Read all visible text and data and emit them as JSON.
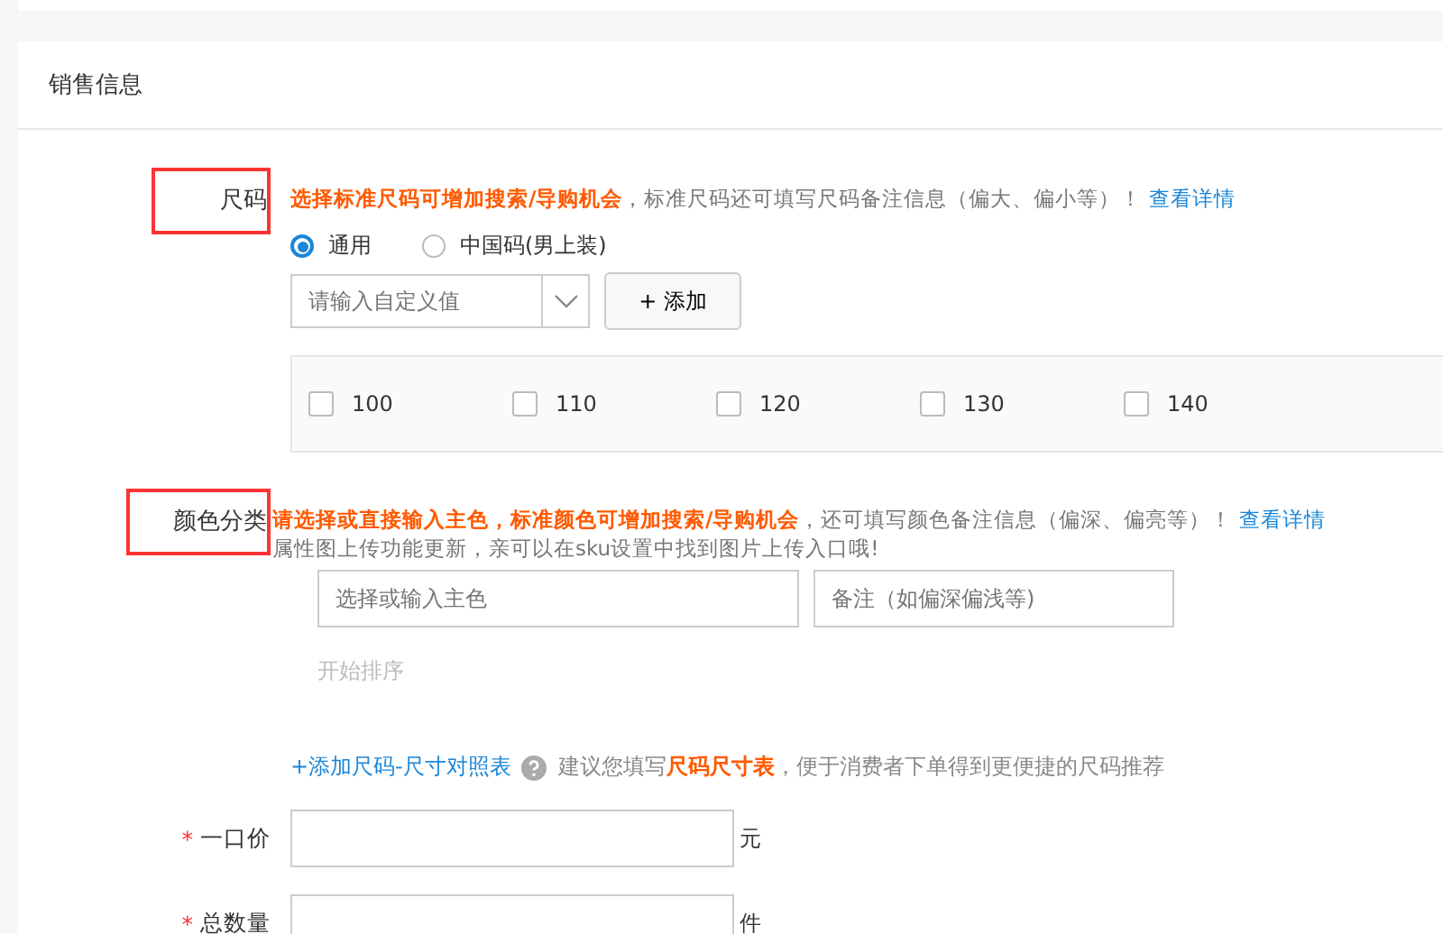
{
  "section_title": "销售信息",
  "size": {
    "label": "尺码",
    "highlighted": true,
    "hint": "**选择标准尺码可增加搜索/导购机会**，标准尺码还可填写尺码备注信息（偏大、偏小等）！",
    "link": "查看详情",
    "radios": [
      {
        "label": "通用",
        "selected": true
      },
      {
        "label": "中国码(男上装)",
        "selected": false
      }
    ],
    "custom_input": {
      "placeholder": "请输入自定义值"
    },
    "add_button": "+ 添加",
    "options": [
      {
        "label": "100",
        "checked": false
      },
      {
        "label": "110",
        "checked": false
      },
      {
        "label": "120",
        "checked": false
      },
      {
        "label": "130",
        "checked": false
      },
      {
        "label": "140",
        "checked": false
      }
    ]
  },
  "color": {
    "label": "颜色分类",
    "highlighted": true,
    "hint": "**请选择或直接输入主色，标准颜色可增加搜索/导购机会**，还可填写颜色备注信息（偏深、偏亮等）！",
    "link": "查看详情",
    "note": "属性图上传功能更新，亲可以在sku设置中找到图片上传入口哦!",
    "main_color": {
      "placeholder": "选择或输入主色"
    },
    "remark": {
      "placeholder": "备注（如偏深偏浅等)"
    },
    "sort": "开始排序"
  },
  "size_chart": {
    "link": "+添加尺码-尺寸对照表",
    "tip": "建议您填写**尺码尺寸表**，便于消费者下单得到更便捷的尺码推荐"
  },
  "fields": [
    {
      "required_mark": "*",
      "label": "一口价",
      "unit": "元"
    },
    {
      "required_mark": "*",
      "label": "总数量",
      "unit": "件"
    }
  ]
}
